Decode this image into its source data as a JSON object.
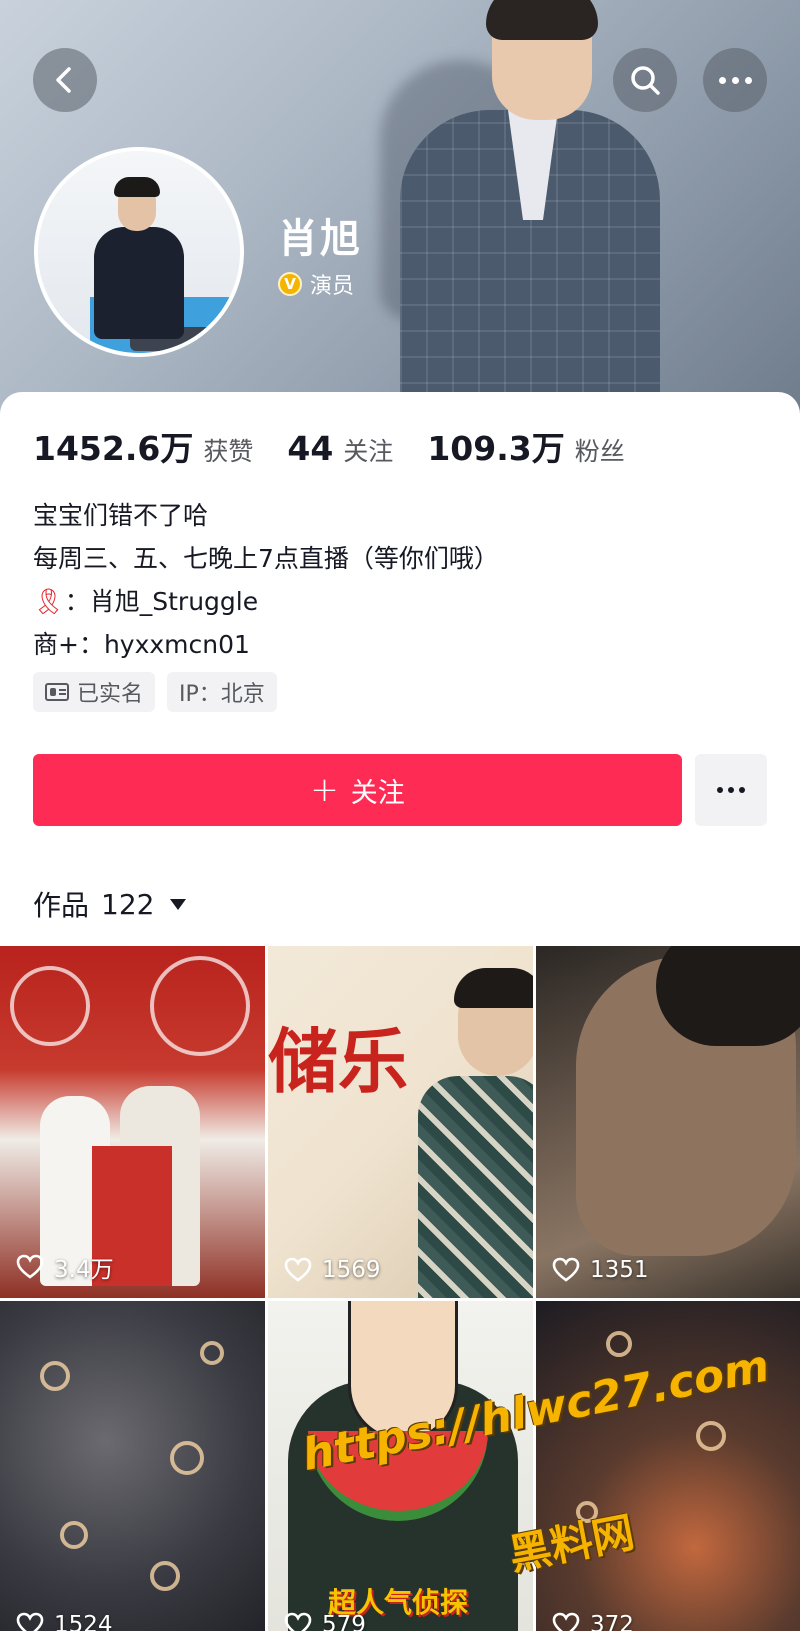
{
  "header": {
    "name": "肖旭",
    "verified_badge": "V",
    "verified_title": "演员",
    "icons": [
      "back-arrow-icon",
      "search-icon",
      "more-icon"
    ]
  },
  "stats": [
    {
      "value": "1452.6万",
      "label": "获赞"
    },
    {
      "value": "44",
      "label": "关注"
    },
    {
      "value": "109.3万",
      "label": "粉丝"
    }
  ],
  "bio": {
    "line1": "宝宝们错不了哈",
    "line2": "每周三、五、七晚上7点直播（等你们哦）",
    "line3_icon": "🎗",
    "line3": "：肖旭_Struggle",
    "line4": "商+：hyxxmcn01"
  },
  "tags": {
    "real_name": "已实名",
    "ip": "IP：北京"
  },
  "actions": {
    "follow_plus": "+",
    "follow_label": "关注"
  },
  "works": {
    "label": "作品",
    "count": "122"
  },
  "videos": [
    {
      "likes": "3.4万"
    },
    {
      "likes": "1569",
      "overlay_text": "储乐"
    },
    {
      "likes": "1351"
    },
    {
      "likes": "1524"
    },
    {
      "likes": "579",
      "overlay_text": "超人气侦探"
    },
    {
      "likes": "372"
    }
  ],
  "watermark": {
    "url": "https://hlwc27.com",
    "site": "黑料网"
  },
  "colors": {
    "accent": "#fe2c55",
    "verified": "#f5b400",
    "text_primary": "#161823",
    "text_secondary": "#57595f"
  }
}
